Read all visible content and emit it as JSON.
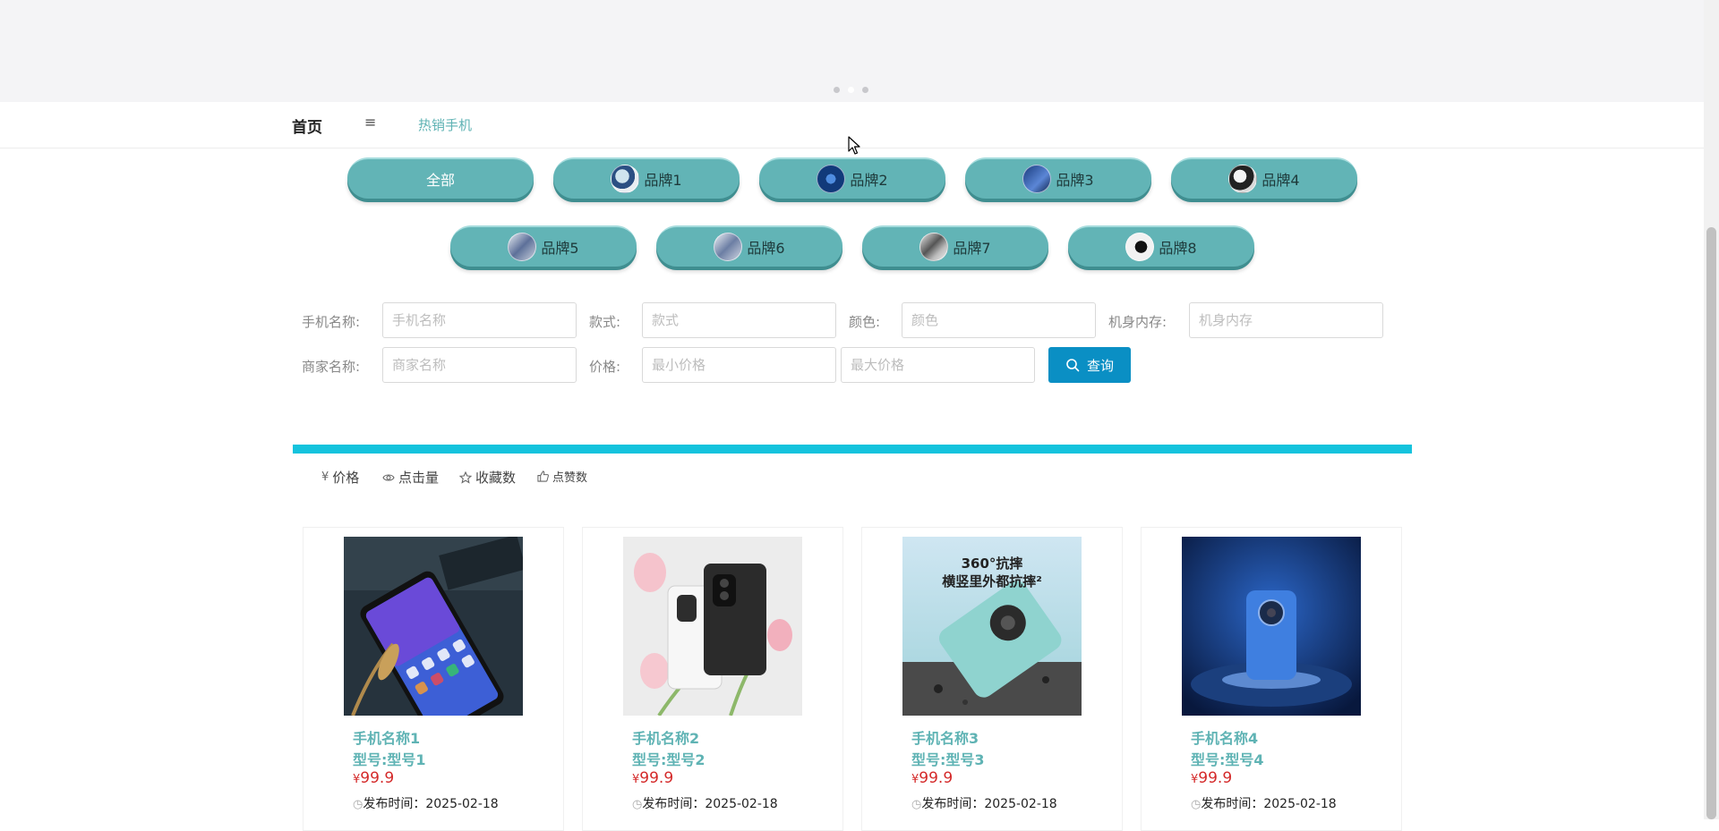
{
  "nav": {
    "home": "首页",
    "menu_icon": "≡",
    "hot": "热销手机"
  },
  "brands": [
    {
      "label": "全部"
    },
    {
      "label": "品牌1",
      "icon": "brand-phone-icon"
    },
    {
      "label": "品牌2",
      "icon": "brand-phone-icon"
    },
    {
      "label": "品牌3",
      "icon": "brand-phone-icon"
    },
    {
      "label": "品牌4",
      "icon": "brand-phone-icon"
    },
    {
      "label": "品牌5",
      "icon": "brand-phone-icon"
    },
    {
      "label": "品牌6",
      "icon": "brand-phone-icon"
    },
    {
      "label": "品牌7",
      "icon": "brand-phone-icon"
    },
    {
      "label": "品牌8",
      "icon": "brand-phone-icon"
    }
  ],
  "search": {
    "name_label": "手机名称:",
    "name_placeholder": "手机名称",
    "style_label": "款式:",
    "style_placeholder": "款式",
    "color_label": "颜色:",
    "color_placeholder": "颜色",
    "memory_label": "机身内存:",
    "memory_placeholder": "机身内存",
    "merchant_label": "商家名称:",
    "merchant_placeholder": "商家名称",
    "price_label": "价格:",
    "min_price_placeholder": "最小价格",
    "max_price_placeholder": "最大价格",
    "button_label": "查询"
  },
  "sort": {
    "price_icon": "¥",
    "price": "价格",
    "clicks_icon": "eye-icon",
    "clicks": "点击量",
    "favorites_icon": "star-icon",
    "favorites": "收藏数",
    "likes_icon": "thumbs-up-icon",
    "likes": "点赞数"
  },
  "products": [
    {
      "name": "手机名称1",
      "model": "型号:型号1",
      "currency": "¥",
      "price": "99.9",
      "date_label": "发布时间：",
      "date": "2025-02-18"
    },
    {
      "name": "手机名称2",
      "model": "型号:型号2",
      "currency": "¥",
      "price": "99.9",
      "date_label": "发布时间：",
      "date": "2025-02-18"
    },
    {
      "name": "手机名称3",
      "model": "型号:型号3",
      "currency": "¥",
      "price": "99.9",
      "date_label": "发布时间：",
      "date": "2025-02-18"
    },
    {
      "name": "手机名称4",
      "model": "型号:型号4",
      "currency": "¥",
      "price": "99.9",
      "date_label": "发布时间：",
      "date": "2025-02-18"
    }
  ],
  "colors": {
    "accent": "#5fb3b4",
    "pill": "#62b4b6",
    "button": "#0a8fc4",
    "divider": "#14c3dd",
    "price": "#d42a2a"
  }
}
